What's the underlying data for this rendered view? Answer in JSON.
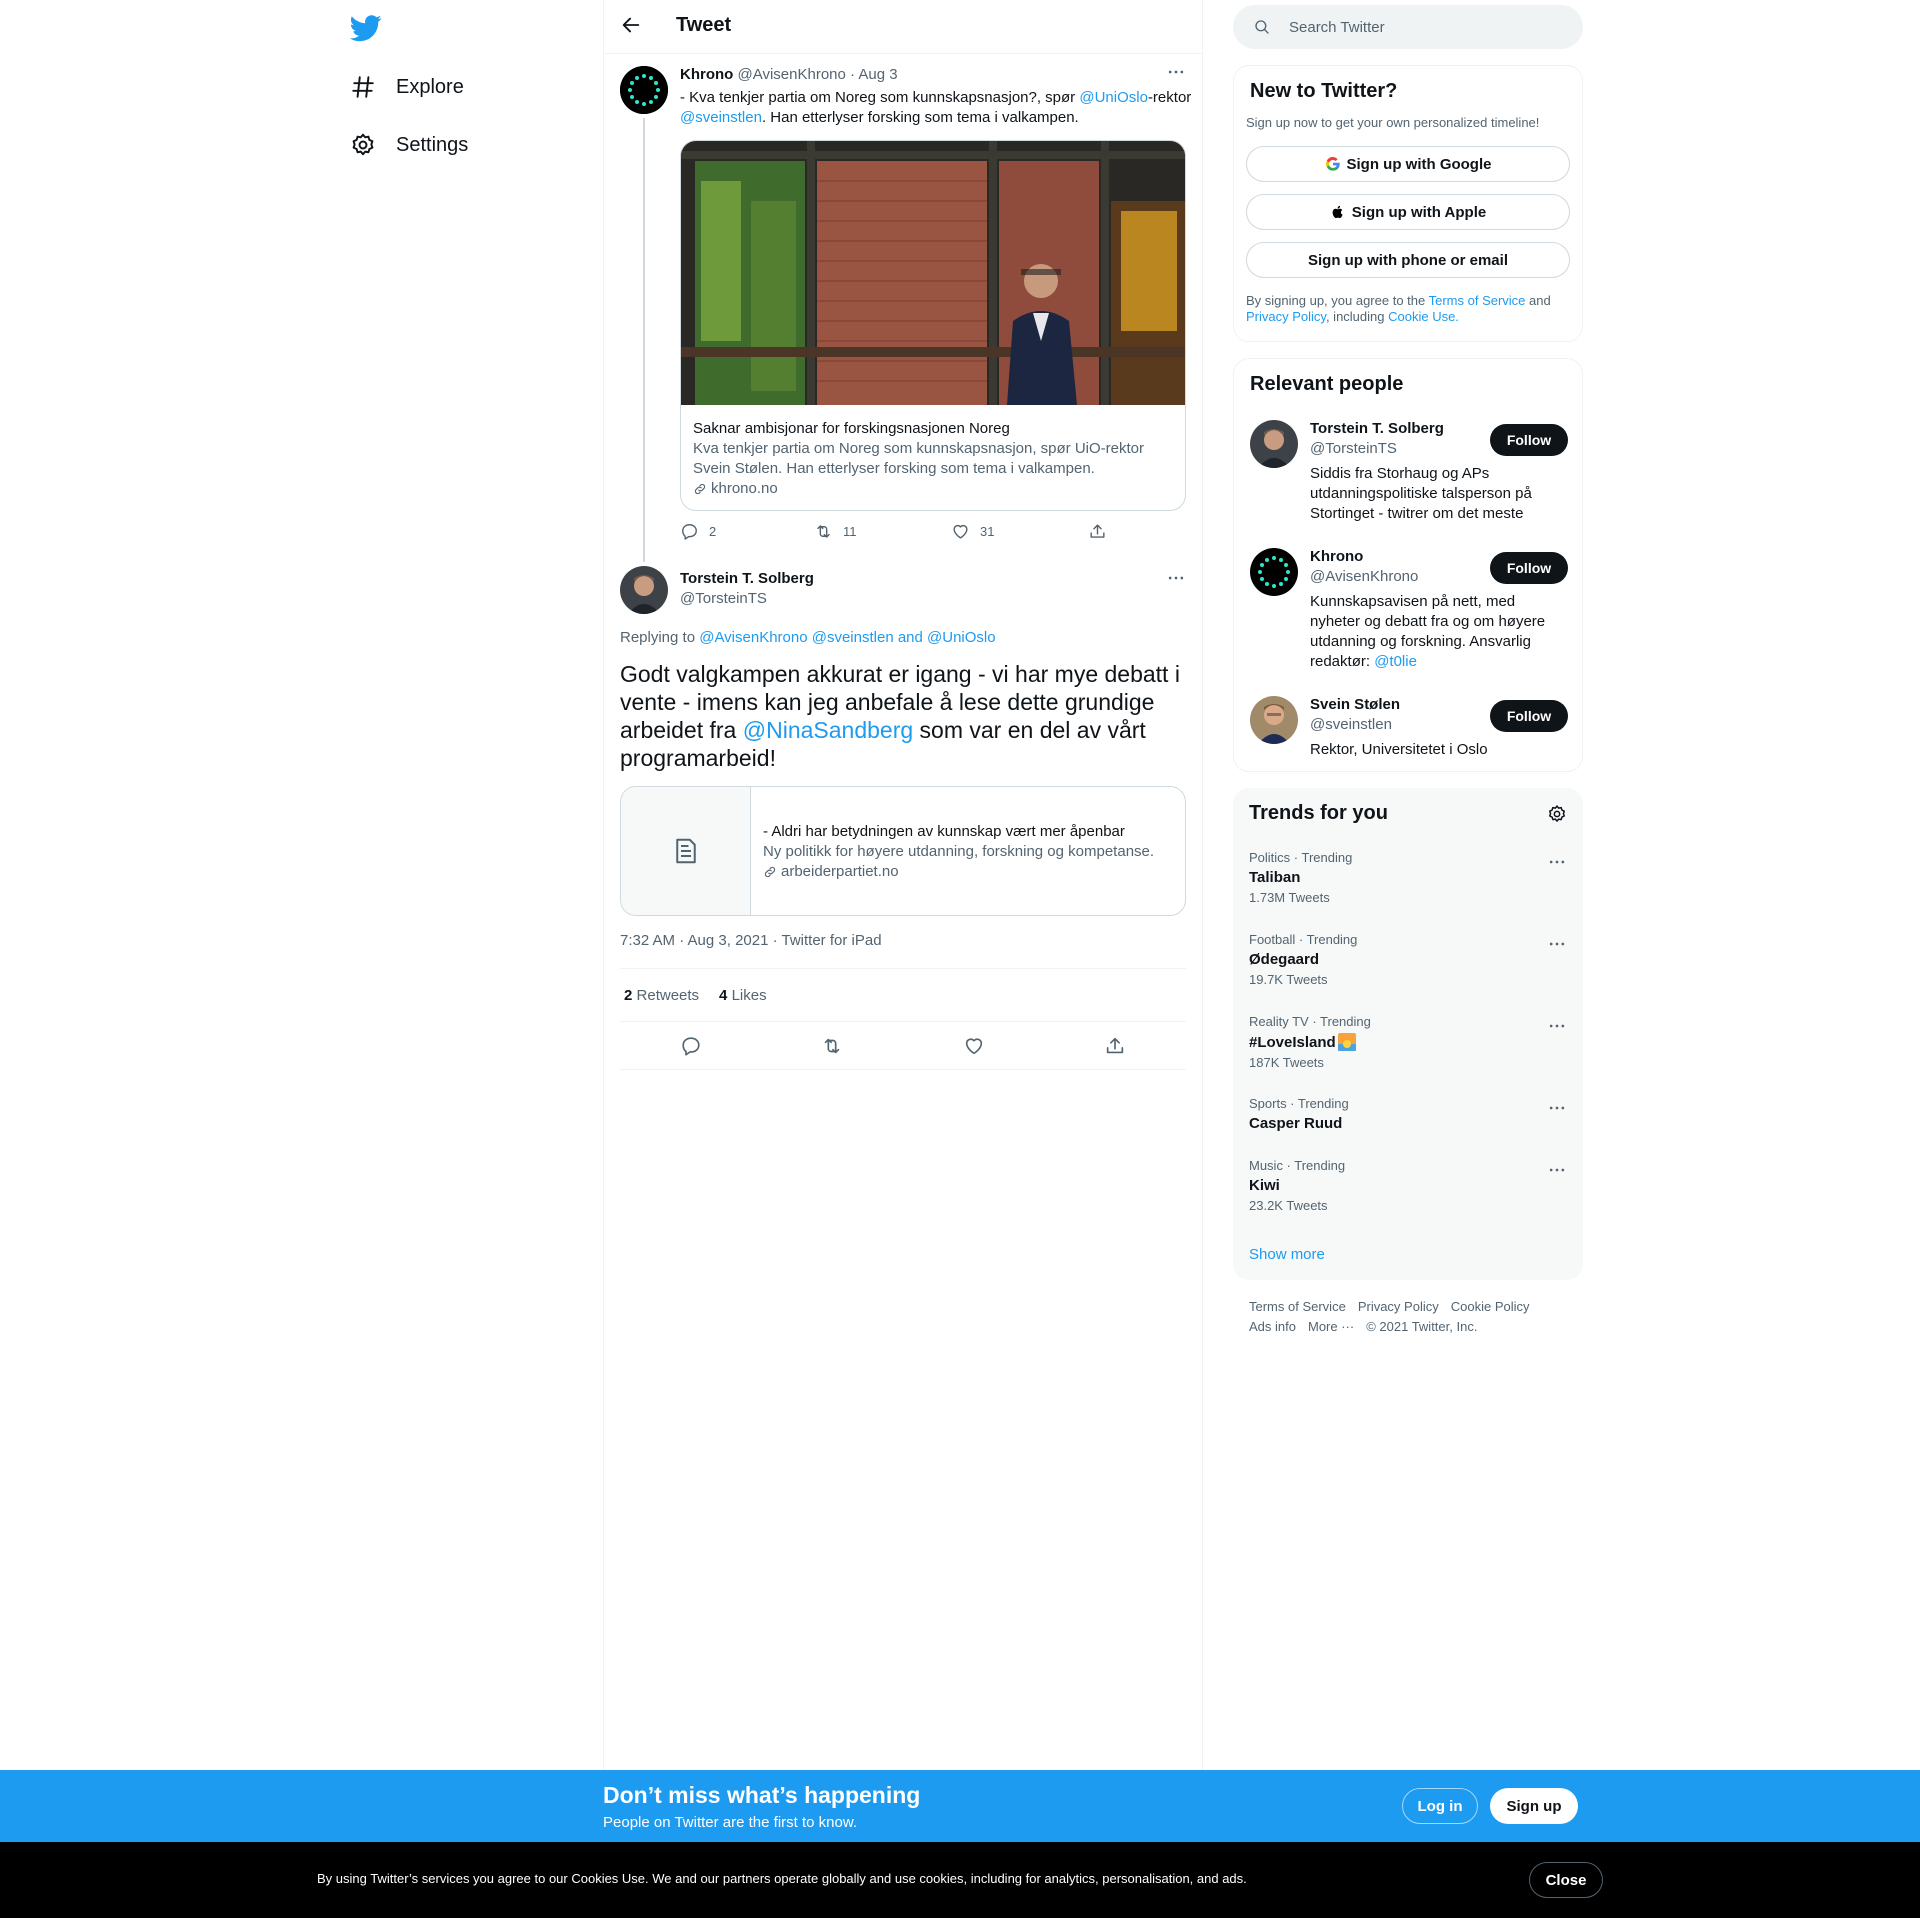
{
  "nav": {
    "items": [
      {
        "label": "Explore",
        "icon": "hashtag-icon"
      },
      {
        "label": "Settings",
        "icon": "gear-icon"
      }
    ]
  },
  "main": {
    "title": "Tweet"
  },
  "tweet1": {
    "name": "Khrono",
    "handle": "@AvisenKhrono",
    "date": "· Aug 3",
    "text_before": "- Kva tenkjer partia om Noreg som kunnskapsnasjon?, spør ",
    "mention1": "@UniOslo",
    "text_mid": "-rektor ",
    "mention2": "@sveinstlen",
    "text_after": ". Han etterlyser forsking som tema i valkampen.",
    "card": {
      "title": "Saknar ambisjonar for forskingsnasjonen Noreg",
      "description": "Kva tenkjer partia om Noreg som kunnskapsnasjon, spør UiO-rektor Svein Stølen. Han etterlyser forsking som tema i valkampen.",
      "domain": "khrono.no"
    },
    "replies": "2",
    "retweets": "11",
    "likes": "31"
  },
  "tweet2": {
    "name": "Torstein T. Solberg",
    "handle": "@TorsteinTS",
    "replying_prefix": "Replying to ",
    "replying_to": "@AvisenKhrono @sveinstlen and @UniOslo",
    "text_before": "Godt valgkampen akkurat er igang - vi har mye debatt i vente - imens kan jeg anbefale å lese dette grundige arbeidet fra ",
    "mention": "@NinaSandberg",
    "text_after": " som var en del av vårt programarbeid!",
    "card": {
      "title": "- Aldri har betydningen av kunnskap vært mer åpenbar",
      "description": "Ny politikk for høyere utdanning, forskning og kompetanse.",
      "domain": "arbeiderpartiet.no"
    },
    "timestamp": "7:32 AM · Aug 3, 2021 · Twitter for iPad",
    "retweet_count": "2",
    "retweet_label": "Retweets",
    "like_count": "4",
    "like_label": "Likes"
  },
  "search": {
    "placeholder": "Search Twitter"
  },
  "new_to_twitter": {
    "title": "New to Twitter?",
    "subtitle": "Sign up now to get your own personalized timeline!",
    "google": "Sign up with Google",
    "apple": "Sign up with Apple",
    "phone": "Sign up with phone or email",
    "legal_1": "By signing up, you agree to the ",
    "tos": "Terms of Service",
    "legal_2": " and ",
    "privacy": "Privacy Policy",
    "legal_3": ", including ",
    "cookie": "Cookie Use."
  },
  "relevant": {
    "title": "Relevant people",
    "follow_label": "Follow",
    "people": [
      {
        "name": "Torstein T. Solberg",
        "handle": "@TorsteinTS",
        "bio": "Siddis fra Storhaug og APs utdanningspolitiske talsperson på Stortinget - twitrer om det meste"
      },
      {
        "name": "Khrono",
        "handle": "@AvisenKhrono",
        "bio": "Kunnskapsavisen på nett, med nyheter og debatt fra og om høyere utdanning og forskning. Ansvarlig redaktør: ",
        "bio_mention": "@t0lie"
      },
      {
        "name": "Svein Stølen",
        "handle": "@sveinstlen",
        "bio": "Rektor, Universitetet i Oslo"
      }
    ]
  },
  "trends": {
    "title": "Trends for you",
    "items": [
      {
        "category": "Politics · Trending",
        "name": "Taliban",
        "count": "1.73M Tweets"
      },
      {
        "category": "Football · Trending",
        "name": "Ødegaard",
        "count": "19.7K Tweets"
      },
      {
        "category": "Reality TV · Trending",
        "name": "#LoveIsland",
        "count": "187K Tweets"
      },
      {
        "category": "Sports · Trending",
        "name": "Casper Ruud",
        "count": ""
      },
      {
        "category": "Music · Trending",
        "name": "Kiwi",
        "count": "23.2K Tweets"
      }
    ],
    "show_more": "Show more"
  },
  "footer": {
    "row1": [
      "Terms of Service",
      "Privacy Policy",
      "Cookie Policy"
    ],
    "row2": [
      "Ads info",
      "More ···",
      "© 2021 Twitter, Inc."
    ]
  },
  "banner": {
    "title": "Don’t miss what’s happening",
    "subtitle": "People on Twitter are the first to know.",
    "login": "Log in",
    "signup": "Sign up"
  },
  "cookie_bar": {
    "text": "By using Twitter’s services you agree to our Cookies Use. We and our partners operate globally and use cookies, including for analytics, personalisation, and ads.",
    "close": "Close"
  },
  "colors": {
    "accent": "#1d9bf0",
    "text": "#0f1419",
    "muted": "#536471",
    "border": "#eff3f4"
  }
}
